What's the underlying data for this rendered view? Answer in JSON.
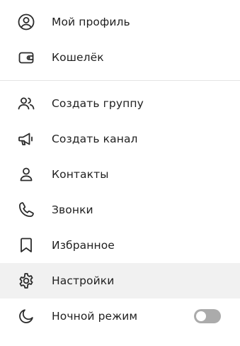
{
  "menu": {
    "items": [
      {
        "label": "Мой профиль",
        "icon": "profile-circle-icon"
      },
      {
        "label": "Кошелёк",
        "icon": "wallet-icon"
      },
      {
        "label": "Создать группу",
        "icon": "group-icon"
      },
      {
        "label": "Создать канал",
        "icon": "megaphone-icon"
      },
      {
        "label": "Контакты",
        "icon": "person-icon"
      },
      {
        "label": "Звонки",
        "icon": "phone-icon"
      },
      {
        "label": "Избранное",
        "icon": "bookmark-icon"
      },
      {
        "label": "Настройки",
        "icon": "gear-icon"
      },
      {
        "label": "Ночной режим",
        "icon": "moon-icon"
      }
    ],
    "night_mode_enabled": false,
    "active_item": "Настройки"
  },
  "colors": {
    "text": "#1f1f1f",
    "icon": "#2b2b2b",
    "active_background": "#f1f1f1",
    "divider": "#e4e4e4",
    "toggle_off": "#ababab"
  }
}
